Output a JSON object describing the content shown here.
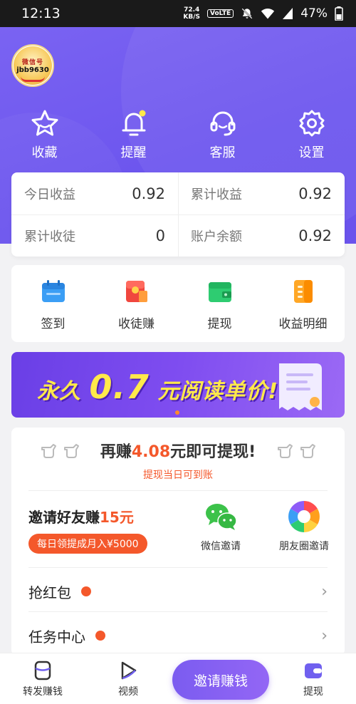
{
  "status_bar": {
    "time": "12:13",
    "speed_value": "72.4",
    "speed_unit": "KB/S",
    "network": "VoLTE",
    "battery": "47%"
  },
  "profile": {
    "avatar_line1": "微信号",
    "avatar_line2": "jbb9630"
  },
  "quick_actions": [
    {
      "label": "收藏",
      "icon": "star-icon"
    },
    {
      "label": "提醒",
      "icon": "bell-icon"
    },
    {
      "label": "客服",
      "icon": "headset-icon"
    },
    {
      "label": "设置",
      "icon": "gear-icon"
    }
  ],
  "stats": {
    "today_label": "今日收益",
    "today_value": "0.92",
    "total_label": "累计收益",
    "total_value": "0.92",
    "apprentices_label": "累计收徒",
    "apprentices_value": "0",
    "balance_label": "账户余额",
    "balance_value": "0.92"
  },
  "tools": [
    {
      "label": "签到",
      "icon": "calendar-icon"
    },
    {
      "label": "收徒赚",
      "icon": "red-packet-icon"
    },
    {
      "label": "提现",
      "icon": "wallet-icon"
    },
    {
      "label": "收益明细",
      "icon": "ledger-icon"
    }
  ],
  "banner": {
    "prefix": "永久",
    "number": "0.7",
    "suffix": "元阅读单价!"
  },
  "earn": {
    "title_pre": "再赚",
    "title_amount": "4.08",
    "title_post": "元即可提现!",
    "subtitle": "提现当日可到账",
    "invite_title_pre": "邀请好友赚",
    "invite_amount": "15元",
    "invite_pill": "每日领提成月入¥5000",
    "wechat_label": "微信邀请",
    "moments_label": "朋友圈邀请"
  },
  "list_rows": [
    {
      "label": "抢红包"
    },
    {
      "label": "任务中心"
    }
  ],
  "tabbar": {
    "forward_label": "转发赚钱",
    "video_label": "视频",
    "invite_label": "邀请赚钱",
    "withdraw_label": "提现"
  },
  "colors": {
    "brand": "#7060ef",
    "accent": "#f4582b"
  }
}
